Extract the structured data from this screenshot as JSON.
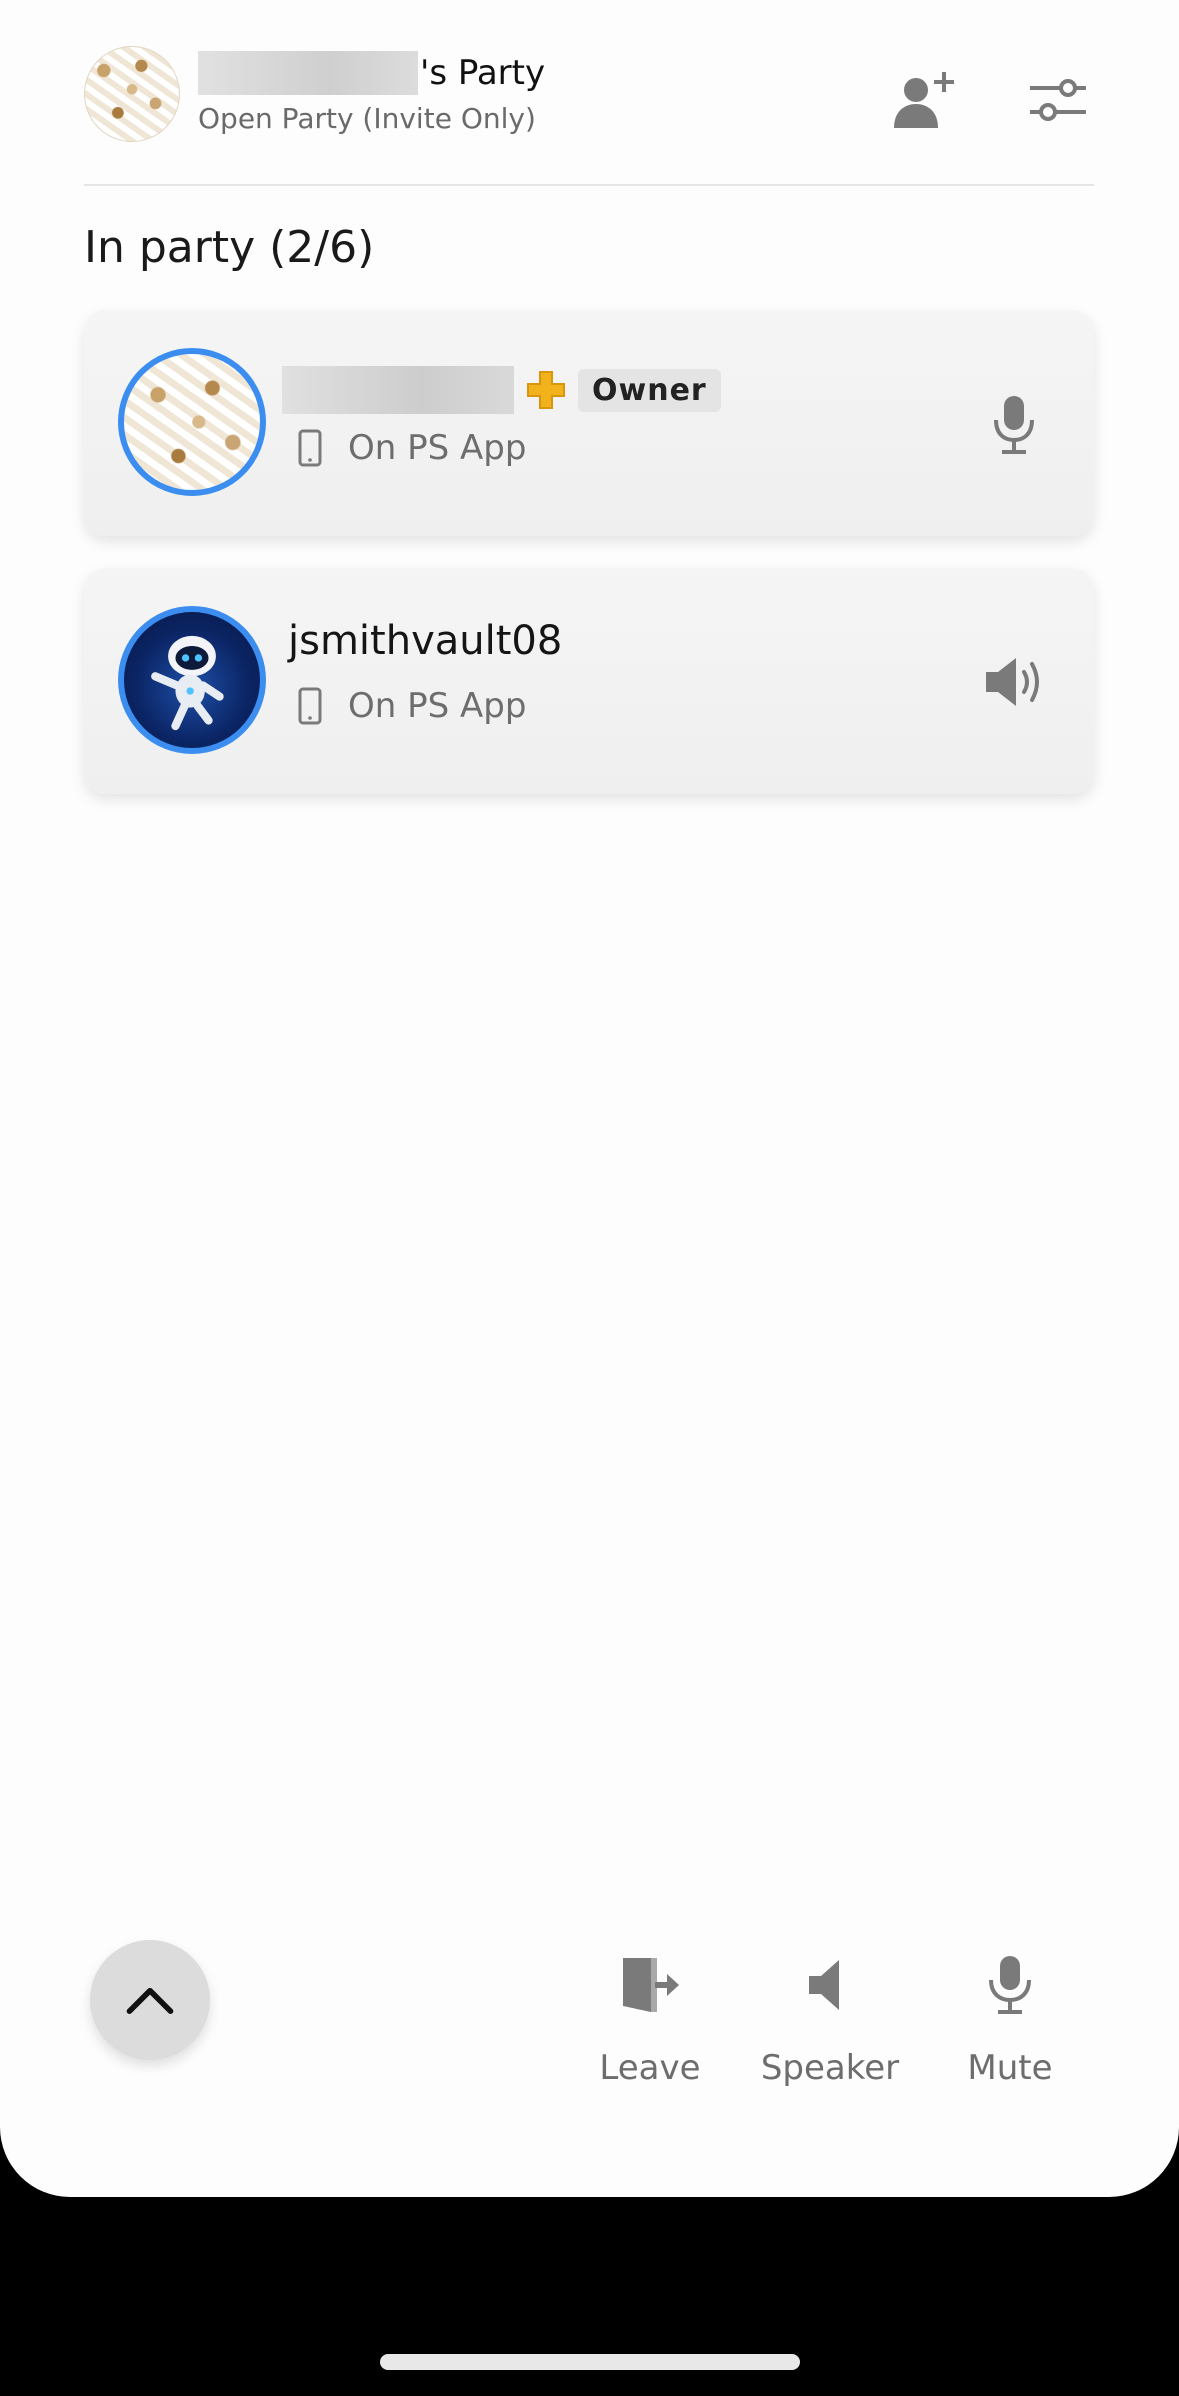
{
  "header": {
    "title": "'s Party",
    "subtitle": "Open Party (Invite Only)",
    "add_icon": "add-user-icon",
    "settings_icon": "sliders-icon"
  },
  "section": {
    "title": "In party (2/6)"
  },
  "members": [
    {
      "name": "",
      "badge": "Owner",
      "plus_icon": "ps-plus-icon",
      "status": "On PS App",
      "status_icon": "phone-icon",
      "action_icon": "microphone-icon"
    },
    {
      "name": "jsmithvault08",
      "status": "On PS App",
      "status_icon": "phone-icon",
      "action_icon": "speaker-volume-icon"
    }
  ],
  "bottom_bar": {
    "collapse_icon": "chevron-up-icon",
    "leave_label": "Leave",
    "speaker_label": "Speaker",
    "mute_label": "Mute"
  },
  "colors": {
    "avatar_ring": "#3b8ef0",
    "icon_gray": "#7a7a7a",
    "plus_gold": "#f2b21b"
  }
}
